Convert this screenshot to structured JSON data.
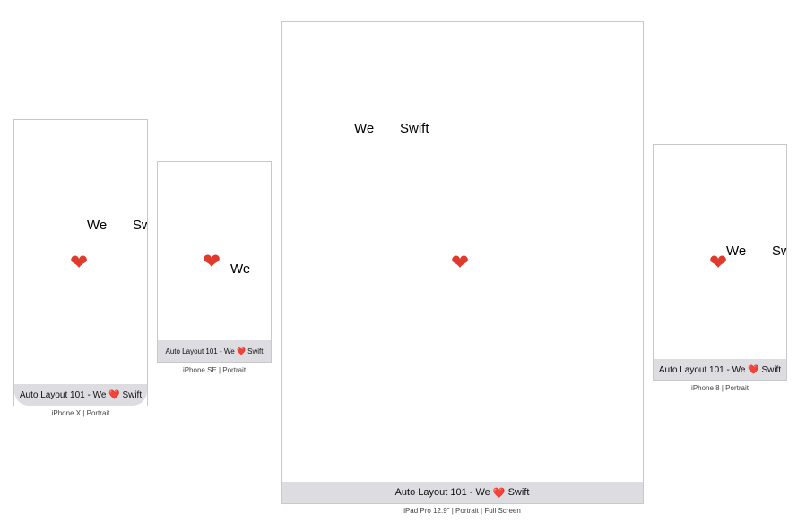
{
  "devices": {
    "iphone_x": {
      "we": "We",
      "swift": "Swift",
      "heart": "❤",
      "bar": {
        "prefix": "Auto Layout 101 - We",
        "heart": "❤️",
        "suffix": "Swift"
      },
      "caption": "iPhone X | Portrait"
    },
    "iphone_se": {
      "we": "We",
      "heart": "❤",
      "bar": {
        "prefix": "Auto Layout 101 - We",
        "heart": "❤️",
        "suffix": "Swift"
      },
      "caption": "iPhone SE | Portrait"
    },
    "ipad_pro": {
      "we": "We",
      "swift": "Swift",
      "heart": "❤",
      "bar": {
        "prefix": "Auto Layout 101 - We",
        "heart": "❤️",
        "suffix": "Swift"
      },
      "caption": "iPad Pro 12.9\" | Portrait | Full Screen"
    },
    "iphone_8": {
      "we": "We",
      "swift": "Swift",
      "heart": "❤",
      "bar": {
        "prefix": "Auto Layout 101 - We",
        "heart": "❤️",
        "suffix": "Swift"
      },
      "caption": "iPhone 8 | Portrait"
    }
  },
  "colors": {
    "heart": "#e03a2c",
    "bar_background": "#dcdce1",
    "device_border": "#c7c7cc"
  }
}
